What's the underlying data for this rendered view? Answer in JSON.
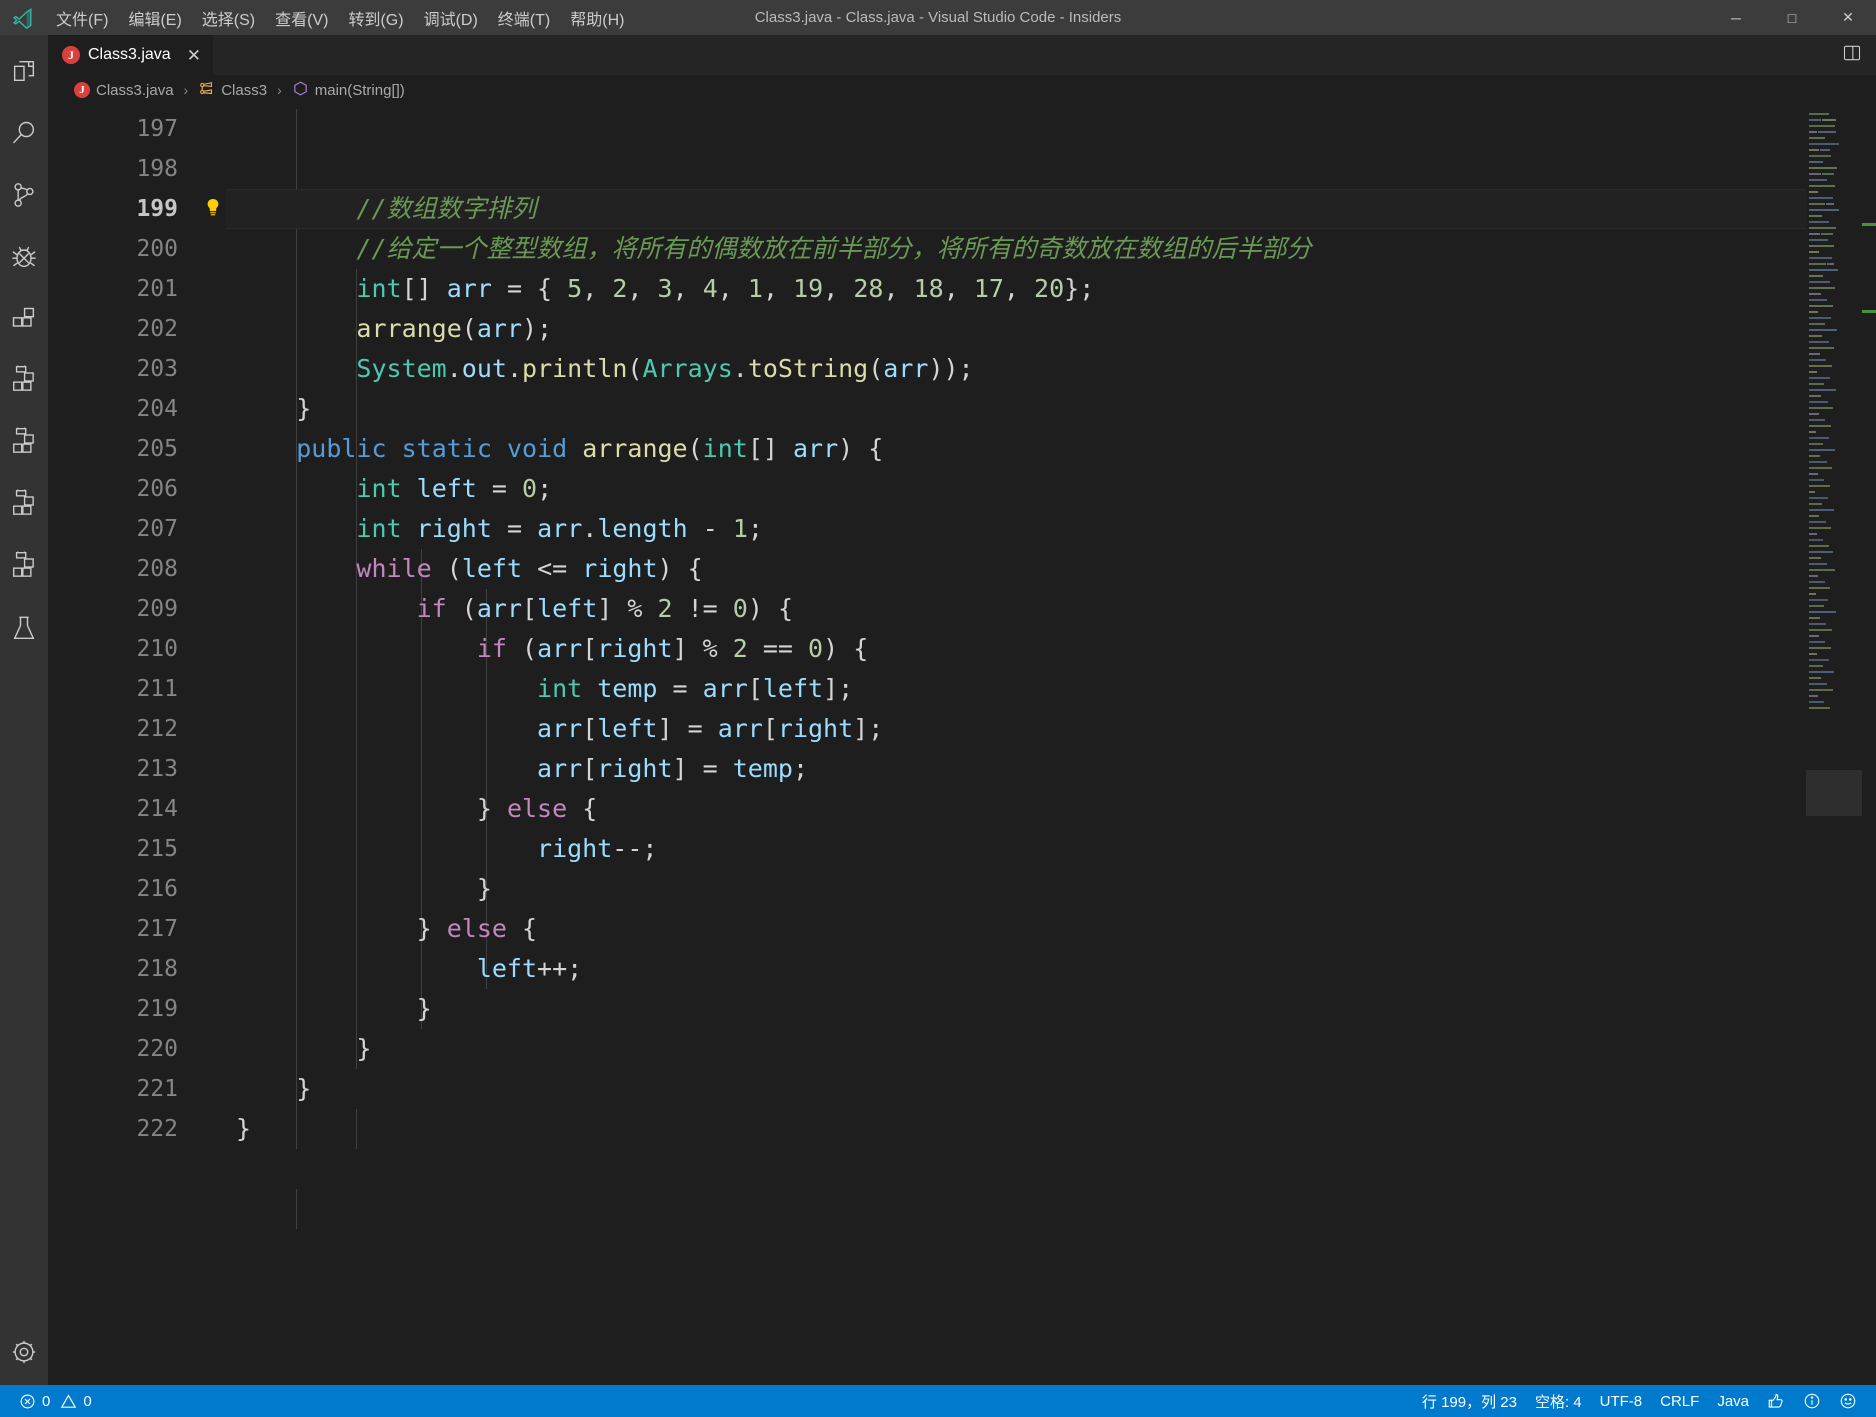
{
  "titlebar": {
    "window_title": "Class3.java - Class.java - Visual Studio Code - Insiders",
    "logo_name": "vscode-logo",
    "menus": [
      {
        "label": "文件(F)",
        "name": "menu-file"
      },
      {
        "label": "编辑(E)",
        "name": "menu-edit"
      },
      {
        "label": "选择(S)",
        "name": "menu-selection"
      },
      {
        "label": "查看(V)",
        "name": "menu-view"
      },
      {
        "label": "转到(G)",
        "name": "menu-go"
      },
      {
        "label": "调试(D)",
        "name": "menu-debug"
      },
      {
        "label": "终端(T)",
        "name": "menu-terminal"
      },
      {
        "label": "帮助(H)",
        "name": "menu-help"
      }
    ],
    "window_controls": {
      "minimize": "─",
      "maximize": "□",
      "close": "✕"
    }
  },
  "activitybar": {
    "items": [
      {
        "name": "explorer-icon",
        "title": "资源管理器"
      },
      {
        "name": "search-icon",
        "title": "搜索"
      },
      {
        "name": "source-control-icon",
        "title": "源代码管理"
      },
      {
        "name": "debug-icon",
        "title": "调试"
      },
      {
        "name": "extensions-icon",
        "title": "扩展"
      },
      {
        "name": "extensions-icon-2",
        "title": "扩展"
      },
      {
        "name": "extensions-icon-3",
        "title": "扩展"
      },
      {
        "name": "extensions-icon-4",
        "title": "扩展"
      },
      {
        "name": "extensions-icon-5",
        "title": "扩展"
      },
      {
        "name": "testing-icon",
        "title": "测试"
      }
    ],
    "bottom": [
      {
        "name": "settings-gear-icon",
        "title": "管理"
      }
    ]
  },
  "tabs": {
    "open": [
      {
        "label": "Class3.java",
        "icon": "java-file-icon",
        "icon_letter": "J",
        "close": "✕",
        "active": true
      }
    ],
    "actions": [
      {
        "name": "split-editor-icon"
      }
    ]
  },
  "breadcrumbs": {
    "items": [
      {
        "label": "Class3.java",
        "icon": "java-file-icon",
        "icon_letter": "J"
      },
      {
        "label": "Class3",
        "icon": "class-symbol-icon"
      },
      {
        "label": "main(String[])",
        "icon": "method-symbol-icon"
      }
    ],
    "separator": "›"
  },
  "editor": {
    "active_line": 199,
    "glyph_hint": {
      "line": 199,
      "icon": "lightbulb-icon",
      "glyph": "💡"
    },
    "lines": [
      {
        "num": "197",
        "text": ""
      },
      {
        "num": "198",
        "text": ""
      },
      {
        "num": "199",
        "text": "        //数组数字排列"
      },
      {
        "num": "200",
        "text": "        //给定一个整型数组，将所有的偶数放在前半部分，将所有的奇数放在数组的后半部分"
      },
      {
        "num": "201",
        "text": "        int[] arr = { 5, 2, 3, 4, 1, 19, 28, 18, 17, 20};"
      },
      {
        "num": "202",
        "text": "        arrange(arr);"
      },
      {
        "num": "203",
        "text": "        System.out.println(Arrays.toString(arr));"
      },
      {
        "num": "204",
        "text": "    }"
      },
      {
        "num": "205",
        "text": "    public static void arrange(int[] arr) {"
      },
      {
        "num": "206",
        "text": "        int left = 0;"
      },
      {
        "num": "207",
        "text": "        int right = arr.length - 1;"
      },
      {
        "num": "208",
        "text": "        while (left <= right) {"
      },
      {
        "num": "209",
        "text": "            if (arr[left] % 2 != 0) {"
      },
      {
        "num": "210",
        "text": "                if (arr[right] % 2 == 0) {"
      },
      {
        "num": "211",
        "text": "                    int temp = arr[left];"
      },
      {
        "num": "212",
        "text": "                    arr[left] = arr[right];"
      },
      {
        "num": "213",
        "text": "                    arr[right] = temp;"
      },
      {
        "num": "214",
        "text": "                } else {"
      },
      {
        "num": "215",
        "text": "                    right--;"
      },
      {
        "num": "216",
        "text": "                }"
      },
      {
        "num": "217",
        "text": "            } else {"
      },
      {
        "num": "218",
        "text": "                left++;"
      },
      {
        "num": "219",
        "text": "            }"
      },
      {
        "num": "220",
        "text": "        }"
      },
      {
        "num": "221",
        "text": "    }"
      },
      {
        "num": "222",
        "text": "}"
      }
    ]
  },
  "statusbar": {
    "left": [
      {
        "name": "problems-status",
        "icon": "error-circle-icon",
        "errors": "0",
        "warn_icon": "warning-triangle-icon",
        "warnings": "0"
      }
    ],
    "right": [
      {
        "name": "cursor-position-status",
        "label": "行 199，列 23"
      },
      {
        "name": "indentation-status",
        "label": "空格: 4"
      },
      {
        "name": "encoding-status",
        "label": "UTF-8"
      },
      {
        "name": "eol-status",
        "label": "CRLF"
      },
      {
        "name": "language-mode-status",
        "label": "Java"
      },
      {
        "name": "feedback-thumbsup-icon",
        "label": "👍"
      },
      {
        "name": "info-icon",
        "label": "ⓘ"
      },
      {
        "name": "smiley-feedback-icon",
        "label": "☺"
      }
    ]
  },
  "colors": {
    "accent": "#007acc",
    "editor_bg": "#1e1e1e",
    "sidebar_bg": "#333333",
    "titlebar_bg": "#3c3c3c",
    "comment": "#6A9955",
    "keyword": "#569CD6",
    "control": "#C586C0",
    "type": "#4EC9B0",
    "variable": "#9CDCFE",
    "number": "#B5CEA8",
    "function": "#DCDCAA",
    "java_icon": "#d9413f"
  }
}
